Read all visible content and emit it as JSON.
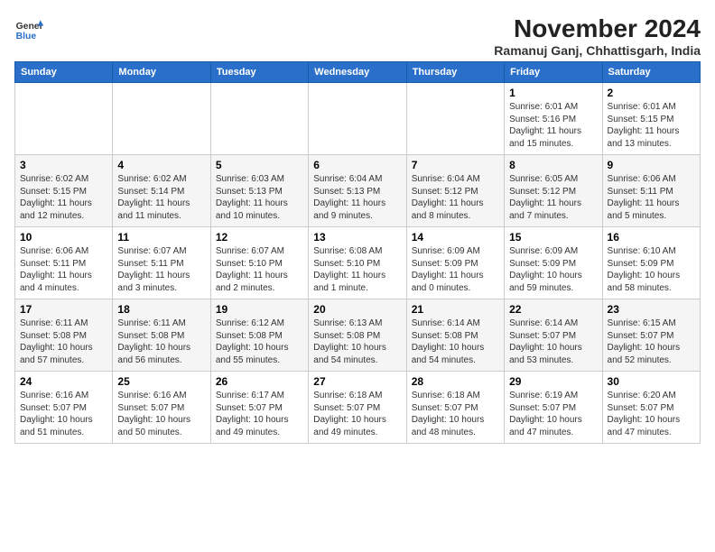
{
  "header": {
    "logo_line1": "General",
    "logo_line2": "Blue",
    "month_title": "November 2024",
    "location": "Ramanuj Ganj, Chhattisgarh, India"
  },
  "weekdays": [
    "Sunday",
    "Monday",
    "Tuesday",
    "Wednesday",
    "Thursday",
    "Friday",
    "Saturday"
  ],
  "weeks": [
    [
      {
        "day": "",
        "info": ""
      },
      {
        "day": "",
        "info": ""
      },
      {
        "day": "",
        "info": ""
      },
      {
        "day": "",
        "info": ""
      },
      {
        "day": "",
        "info": ""
      },
      {
        "day": "1",
        "info": "Sunrise: 6:01 AM\nSunset: 5:16 PM\nDaylight: 11 hours and 15 minutes."
      },
      {
        "day": "2",
        "info": "Sunrise: 6:01 AM\nSunset: 5:15 PM\nDaylight: 11 hours and 13 minutes."
      }
    ],
    [
      {
        "day": "3",
        "info": "Sunrise: 6:02 AM\nSunset: 5:15 PM\nDaylight: 11 hours and 12 minutes."
      },
      {
        "day": "4",
        "info": "Sunrise: 6:02 AM\nSunset: 5:14 PM\nDaylight: 11 hours and 11 minutes."
      },
      {
        "day": "5",
        "info": "Sunrise: 6:03 AM\nSunset: 5:13 PM\nDaylight: 11 hours and 10 minutes."
      },
      {
        "day": "6",
        "info": "Sunrise: 6:04 AM\nSunset: 5:13 PM\nDaylight: 11 hours and 9 minutes."
      },
      {
        "day": "7",
        "info": "Sunrise: 6:04 AM\nSunset: 5:12 PM\nDaylight: 11 hours and 8 minutes."
      },
      {
        "day": "8",
        "info": "Sunrise: 6:05 AM\nSunset: 5:12 PM\nDaylight: 11 hours and 7 minutes."
      },
      {
        "day": "9",
        "info": "Sunrise: 6:06 AM\nSunset: 5:11 PM\nDaylight: 11 hours and 5 minutes."
      }
    ],
    [
      {
        "day": "10",
        "info": "Sunrise: 6:06 AM\nSunset: 5:11 PM\nDaylight: 11 hours and 4 minutes."
      },
      {
        "day": "11",
        "info": "Sunrise: 6:07 AM\nSunset: 5:11 PM\nDaylight: 11 hours and 3 minutes."
      },
      {
        "day": "12",
        "info": "Sunrise: 6:07 AM\nSunset: 5:10 PM\nDaylight: 11 hours and 2 minutes."
      },
      {
        "day": "13",
        "info": "Sunrise: 6:08 AM\nSunset: 5:10 PM\nDaylight: 11 hours and 1 minute."
      },
      {
        "day": "14",
        "info": "Sunrise: 6:09 AM\nSunset: 5:09 PM\nDaylight: 11 hours and 0 minutes."
      },
      {
        "day": "15",
        "info": "Sunrise: 6:09 AM\nSunset: 5:09 PM\nDaylight: 10 hours and 59 minutes."
      },
      {
        "day": "16",
        "info": "Sunrise: 6:10 AM\nSunset: 5:09 PM\nDaylight: 10 hours and 58 minutes."
      }
    ],
    [
      {
        "day": "17",
        "info": "Sunrise: 6:11 AM\nSunset: 5:08 PM\nDaylight: 10 hours and 57 minutes."
      },
      {
        "day": "18",
        "info": "Sunrise: 6:11 AM\nSunset: 5:08 PM\nDaylight: 10 hours and 56 minutes."
      },
      {
        "day": "19",
        "info": "Sunrise: 6:12 AM\nSunset: 5:08 PM\nDaylight: 10 hours and 55 minutes."
      },
      {
        "day": "20",
        "info": "Sunrise: 6:13 AM\nSunset: 5:08 PM\nDaylight: 10 hours and 54 minutes."
      },
      {
        "day": "21",
        "info": "Sunrise: 6:14 AM\nSunset: 5:08 PM\nDaylight: 10 hours and 54 minutes."
      },
      {
        "day": "22",
        "info": "Sunrise: 6:14 AM\nSunset: 5:07 PM\nDaylight: 10 hours and 53 minutes."
      },
      {
        "day": "23",
        "info": "Sunrise: 6:15 AM\nSunset: 5:07 PM\nDaylight: 10 hours and 52 minutes."
      }
    ],
    [
      {
        "day": "24",
        "info": "Sunrise: 6:16 AM\nSunset: 5:07 PM\nDaylight: 10 hours and 51 minutes."
      },
      {
        "day": "25",
        "info": "Sunrise: 6:16 AM\nSunset: 5:07 PM\nDaylight: 10 hours and 50 minutes."
      },
      {
        "day": "26",
        "info": "Sunrise: 6:17 AM\nSunset: 5:07 PM\nDaylight: 10 hours and 49 minutes."
      },
      {
        "day": "27",
        "info": "Sunrise: 6:18 AM\nSunset: 5:07 PM\nDaylight: 10 hours and 49 minutes."
      },
      {
        "day": "28",
        "info": "Sunrise: 6:18 AM\nSunset: 5:07 PM\nDaylight: 10 hours and 48 minutes."
      },
      {
        "day": "29",
        "info": "Sunrise: 6:19 AM\nSunset: 5:07 PM\nDaylight: 10 hours and 47 minutes."
      },
      {
        "day": "30",
        "info": "Sunrise: 6:20 AM\nSunset: 5:07 PM\nDaylight: 10 hours and 47 minutes."
      }
    ]
  ]
}
